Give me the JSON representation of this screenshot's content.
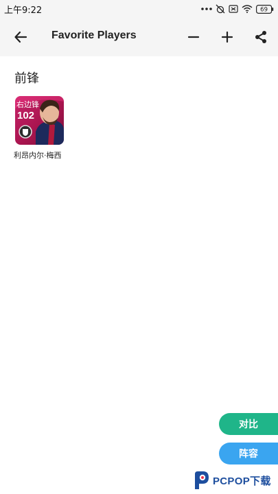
{
  "status_bar": {
    "time": "上午9:22",
    "battery_level": "69"
  },
  "app_bar": {
    "title": "Favorite Players"
  },
  "section": {
    "title": "前锋"
  },
  "players": [
    {
      "position_badge": "右边锋",
      "rating": "102",
      "name": "利昂内尔·梅西"
    }
  ],
  "actions": {
    "compare_label": "对比",
    "lineup_label": "阵容"
  },
  "watermark": {
    "text": "PCPOP下载"
  },
  "colors": {
    "compare_button": "#1fb589",
    "lineup_button": "#3aa5f0",
    "card_background": "#c8246a",
    "watermark": "#1d4e9e"
  }
}
